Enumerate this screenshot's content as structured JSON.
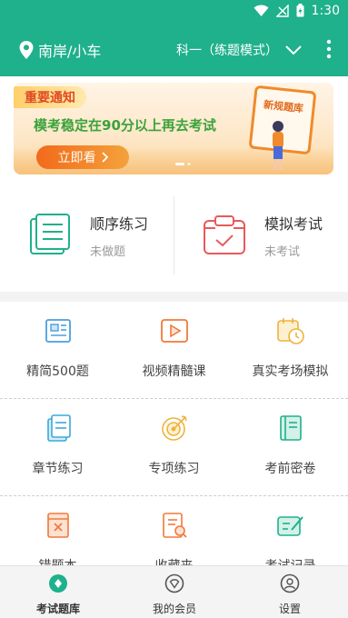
{
  "status_bar": {
    "time": "1:30",
    "icons": [
      "wifi-icon",
      "signal-icon",
      "battery-icon"
    ]
  },
  "app_bar": {
    "location": "南岸/小车",
    "mode": "科一（练题模式）",
    "icons": [
      "location-pin-icon",
      "chevron-down-icon",
      "more-vert-icon"
    ]
  },
  "banner": {
    "tag": "重要通知",
    "headline": "模考稳定在90分以上再去考试",
    "button": "立即看",
    "board_title": "新规题库"
  },
  "practice": [
    {
      "title": "顺序练习",
      "status": "未做题",
      "icon": "list-pages-icon",
      "color": "#1fb08c"
    },
    {
      "title": "模拟考试",
      "status": "未考试",
      "icon": "exam-calendar-icon",
      "color": "#e85a5a"
    }
  ],
  "features": [
    {
      "label": "精简500题",
      "icon": "newspaper-icon",
      "color": "#4a9fe0"
    },
    {
      "label": "视频精髓课",
      "icon": "video-play-icon",
      "color": "#f07a3a"
    },
    {
      "label": "真实考场模拟",
      "icon": "calendar-clock-icon",
      "color": "#f0b33a"
    },
    {
      "label": "章节练习",
      "icon": "document-stack-icon",
      "color": "#3aa8d8"
    },
    {
      "label": "专项练习",
      "icon": "target-icon",
      "color": "#f0b33a"
    },
    {
      "label": "考前密卷",
      "icon": "book-icon",
      "color": "#1fb08c"
    },
    {
      "label": "错题本",
      "icon": "wrong-questions-icon",
      "color": "#f07a3a"
    },
    {
      "label": "收藏夹",
      "icon": "favorites-search-icon",
      "color": "#f07a3a"
    },
    {
      "label": "考试记录",
      "icon": "edit-record-icon",
      "color": "#1fb08c"
    }
  ],
  "tabs": [
    {
      "label": "考试题库",
      "icon": "question-bank-icon",
      "active": true,
      "color": "#1fb08c"
    },
    {
      "label": "我的会员",
      "icon": "member-icon",
      "active": false,
      "color": "#555555"
    },
    {
      "label": "设置",
      "icon": "settings-user-icon",
      "active": false,
      "color": "#555555"
    }
  ]
}
